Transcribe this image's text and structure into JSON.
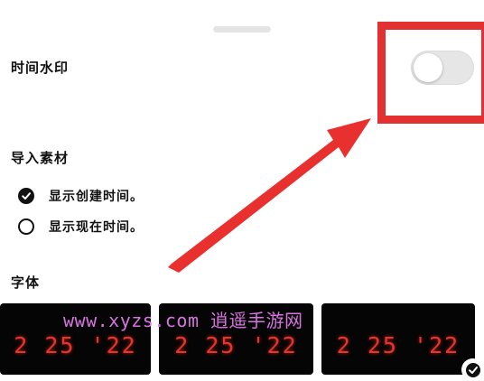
{
  "time_watermark": {
    "label": "时间水印",
    "toggle_on": false
  },
  "import_material": {
    "label": "导入素材",
    "options": [
      {
        "label": "显示创建时间。",
        "selected": true
      },
      {
        "label": "显示现在时间。",
        "selected": false
      }
    ]
  },
  "font": {
    "label": "字体",
    "samples": [
      "2 25 '22",
      "2 25 '22",
      "2 25 '22"
    ],
    "selected_index": 2
  },
  "watermark_overlay": "www.xyzs.com 逍遥手游网",
  "colors": {
    "highlight_red": "#e33131",
    "sample_red": "#e8342b",
    "watermark_pink": "#d774e0"
  },
  "icons": {
    "option_checked": "check-circle-filled-icon",
    "option_unchecked": "circle-outline-icon",
    "card_selected": "check-badge-icon"
  }
}
